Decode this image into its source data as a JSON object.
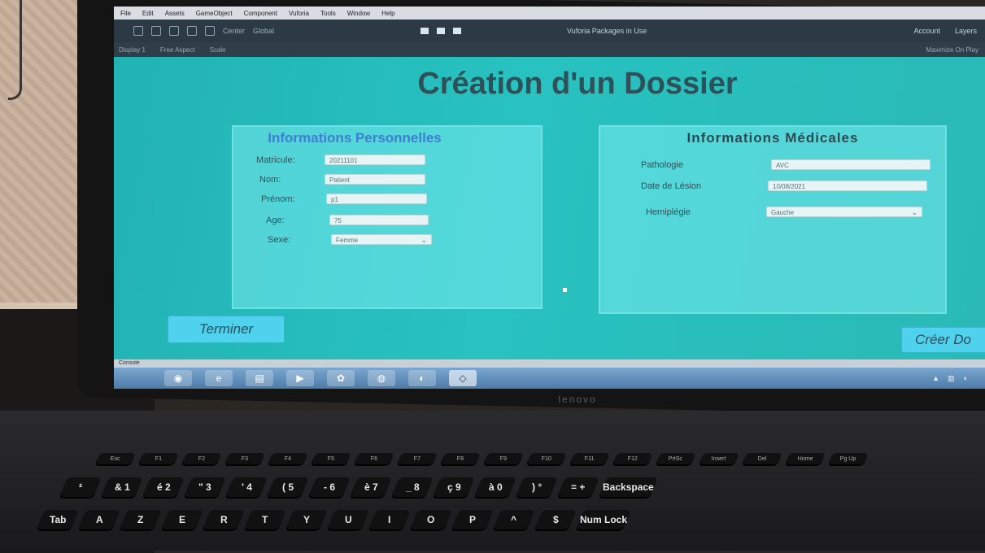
{
  "menubar": {
    "items": [
      "File",
      "Edit",
      "Assets",
      "GameObject",
      "Component",
      "Vuforia",
      "Tools",
      "Window",
      "Help"
    ]
  },
  "toolbar": {
    "center_label": "Center",
    "global_label": "Global",
    "package_label": "Vuforia Packages in Use",
    "account_label": "Account",
    "layers_label": "Layers"
  },
  "gamebar": {
    "display": "Display 1",
    "aspect": "Free Aspect",
    "scale": "Scale",
    "maximize": "Maximize On Play"
  },
  "form": {
    "title": "Création d'un Dossier",
    "personal": {
      "title": "Informations Personnelles",
      "matricule_label": "Matricule:",
      "matricule_value": "20211101",
      "nom_label": "Nom:",
      "nom_value": "Patient",
      "prenom_label": "Prénom:",
      "prenom_value": "p1",
      "age_label": "Age:",
      "age_value": "75",
      "sexe_label": "Sexe:",
      "sexe_value": "Femme"
    },
    "medical": {
      "title": "Informations Médicales",
      "pathologie_label": "Pathologie",
      "pathologie_value": "AVC",
      "date_label": "Date de Lésion",
      "date_value": "10/08/2021",
      "hemiplegie_label": "Hemiplégie",
      "hemiplegie_value": "Gauche"
    },
    "terminer_label": "Terminer",
    "creer_label": "Créer Do"
  },
  "console": {
    "label": "Console"
  },
  "laptop": {
    "brand": "lenovo"
  },
  "keyboard": {
    "fn_row": [
      "Esc",
      "F1",
      "F2",
      "F3",
      "F4",
      "F5",
      "F6",
      "F7",
      "F8",
      "F9",
      "F10",
      "F11",
      "F12",
      "PrtSc",
      "Insert",
      "Del",
      "Home",
      "Pg Up"
    ],
    "number_row": [
      "²",
      "& 1",
      "é 2",
      "\" 3",
      "' 4",
      "( 5",
      "- 6",
      "è 7",
      "_ 8",
      "ç 9",
      "à 0",
      ") °",
      "= +",
      "Backspace"
    ],
    "letter_row": [
      "Tab",
      "A",
      "Z",
      "E",
      "R",
      "T",
      "Y",
      "U",
      "I",
      "O",
      "P",
      "^",
      "$",
      "Num Lock"
    ]
  },
  "colors": {
    "game_bg": "#28c2c0",
    "title": "#2f4f59",
    "personal_title": "#3d7fd0",
    "button": "#4fd2ee"
  }
}
